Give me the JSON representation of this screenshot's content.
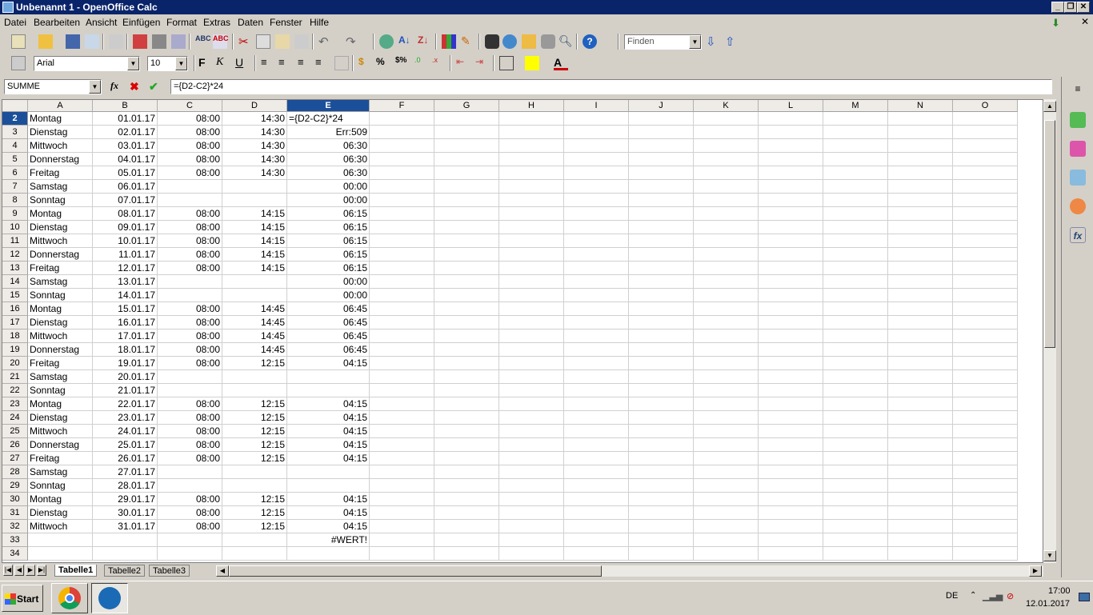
{
  "window": {
    "title": "Unbenannt 1 - OpenOffice Calc"
  },
  "menu": [
    "Datei",
    "Bearbeiten",
    "Ansicht",
    "Einfügen",
    "Format",
    "Extras",
    "Daten",
    "Fenster",
    "Hilfe"
  ],
  "toolbar": {
    "find_placeholder": "Finden",
    "font_name": "Arial",
    "font_size": "10"
  },
  "formula_bar": {
    "name_box": "SUMME",
    "formula": "={D2-C2}*24"
  },
  "columns": [
    "A",
    "B",
    "C",
    "D",
    "E",
    "F",
    "G",
    "H",
    "I",
    "J",
    "K",
    "L",
    "M",
    "N",
    "O"
  ],
  "selected_column": "E",
  "selected_row": "2",
  "rows": [
    {
      "n": "2",
      "a": "Montag",
      "b": "01.01.17",
      "c": "08:00",
      "d": "14:30",
      "e": "={D2-C2}*24"
    },
    {
      "n": "3",
      "a": "Dienstag",
      "b": "02.01.17",
      "c": "08:00",
      "d": "14:30",
      "e": "Err:509"
    },
    {
      "n": "4",
      "a": "Mittwoch",
      "b": "03.01.17",
      "c": "08:00",
      "d": "14:30",
      "e": "06:30"
    },
    {
      "n": "5",
      "a": "Donnerstag",
      "b": "04.01.17",
      "c": "08:00",
      "d": "14:30",
      "e": "06:30"
    },
    {
      "n": "6",
      "a": "Freitag",
      "b": "05.01.17",
      "c": "08:00",
      "d": "14:30",
      "e": "06:30"
    },
    {
      "n": "7",
      "a": "Samstag",
      "b": "06.01.17",
      "c": "",
      "d": "",
      "e": "00:00"
    },
    {
      "n": "8",
      "a": "Sonntag",
      "b": "07.01.17",
      "c": "",
      "d": "",
      "e": "00:00"
    },
    {
      "n": "9",
      "a": "Montag",
      "b": "08.01.17",
      "c": "08:00",
      "d": "14:15",
      "e": "06:15"
    },
    {
      "n": "10",
      "a": "Dienstag",
      "b": "09.01.17",
      "c": "08:00",
      "d": "14:15",
      "e": "06:15"
    },
    {
      "n": "11",
      "a": "Mittwoch",
      "b": "10.01.17",
      "c": "08:00",
      "d": "14:15",
      "e": "06:15"
    },
    {
      "n": "12",
      "a": "Donnerstag",
      "b": "11.01.17",
      "c": "08:00",
      "d": "14:15",
      "e": "06:15"
    },
    {
      "n": "13",
      "a": "Freitag",
      "b": "12.01.17",
      "c": "08:00",
      "d": "14:15",
      "e": "06:15"
    },
    {
      "n": "14",
      "a": "Samstag",
      "b": "13.01.17",
      "c": "",
      "d": "",
      "e": "00:00"
    },
    {
      "n": "15",
      "a": "Sonntag",
      "b": "14.01.17",
      "c": "",
      "d": "",
      "e": "00:00"
    },
    {
      "n": "16",
      "a": "Montag",
      "b": "15.01.17",
      "c": "08:00",
      "d": "14:45",
      "e": "06:45"
    },
    {
      "n": "17",
      "a": "Dienstag",
      "b": "16.01.17",
      "c": "08:00",
      "d": "14:45",
      "e": "06:45"
    },
    {
      "n": "18",
      "a": "Mittwoch",
      "b": "17.01.17",
      "c": "08:00",
      "d": "14:45",
      "e": "06:45"
    },
    {
      "n": "19",
      "a": "Donnerstag",
      "b": "18.01.17",
      "c": "08:00",
      "d": "14:45",
      "e": "06:45"
    },
    {
      "n": "20",
      "a": "Freitag",
      "b": "19.01.17",
      "c": "08:00",
      "d": "12:15",
      "e": "04:15"
    },
    {
      "n": "21",
      "a": "Samstag",
      "b": "20.01.17",
      "c": "",
      "d": "",
      "e": ""
    },
    {
      "n": "22",
      "a": "Sonntag",
      "b": "21.01.17",
      "c": "",
      "d": "",
      "e": ""
    },
    {
      "n": "23",
      "a": "Montag",
      "b": "22.01.17",
      "c": "08:00",
      "d": "12:15",
      "e": "04:15"
    },
    {
      "n": "24",
      "a": "Dienstag",
      "b": "23.01.17",
      "c": "08:00",
      "d": "12:15",
      "e": "04:15"
    },
    {
      "n": "25",
      "a": "Mittwoch",
      "b": "24.01.17",
      "c": "08:00",
      "d": "12:15",
      "e": "04:15"
    },
    {
      "n": "26",
      "a": "Donnerstag",
      "b": "25.01.17",
      "c": "08:00",
      "d": "12:15",
      "e": "04:15"
    },
    {
      "n": "27",
      "a": "Freitag",
      "b": "26.01.17",
      "c": "08:00",
      "d": "12:15",
      "e": "04:15"
    },
    {
      "n": "28",
      "a": "Samstag",
      "b": "27.01.17",
      "c": "",
      "d": "",
      "e": ""
    },
    {
      "n": "29",
      "a": "Sonntag",
      "b": "28.01.17",
      "c": "",
      "d": "",
      "e": ""
    },
    {
      "n": "30",
      "a": "Montag",
      "b": "29.01.17",
      "c": "08:00",
      "d": "12:15",
      "e": "04:15"
    },
    {
      "n": "31",
      "a": "Dienstag",
      "b": "30.01.17",
      "c": "08:00",
      "d": "12:15",
      "e": "04:15"
    },
    {
      "n": "32",
      "a": "Mittwoch",
      "b": "31.01.17",
      "c": "08:00",
      "d": "12:15",
      "e": "04:15"
    },
    {
      "n": "33",
      "a": "",
      "b": "",
      "c": "",
      "d": "",
      "e": "#WERT!"
    },
    {
      "n": "34",
      "a": "",
      "b": "",
      "c": "",
      "d": "",
      "e": ""
    }
  ],
  "sheets": [
    "Tabelle1",
    "Tabelle2",
    "Tabelle3"
  ],
  "active_sheet": "Tabelle1",
  "taskbar": {
    "start_label": "Start",
    "language": "DE",
    "time": "17:00",
    "date": "12.01.2017"
  }
}
